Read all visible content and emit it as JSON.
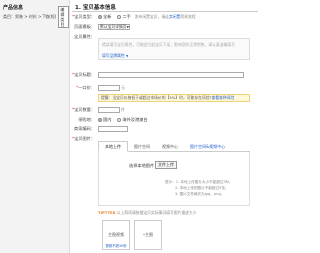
{
  "sidebar": {
    "title": "产品信息",
    "crumb": "类目：男装 > 衬衫 > T恤(短)",
    "edit_label": "编辑类目"
  },
  "section": {
    "title": "1. 宝贝基本信息"
  },
  "form": {
    "type_label": "宝贝类型：",
    "type_options": [
      "全新",
      "二手"
    ],
    "type_hint": "发布闲置宝贝，请走",
    "type_hint_link": "卖闲置",
    "type_hint_tail": "简易流程",
    "attr_label": "页面模板：",
    "attr_select": "默认宝贝详情页",
    "props_label": "宝贝属性：",
    "props_placeholder": "错误填写宝贝属性，可能会引起宝贝下架，影响您的正常销售，请认真准确填写",
    "props_link": "填写品牌属性",
    "title_label": "宝贝标题：",
    "title_counter": "还能输入 30 字",
    "price_label": "一口价：",
    "price_unit": "元",
    "warning_text": "提醒：当宝贝价格低于或超过市场价的【5%】时，可能存在风险?",
    "warning_link": "查看各种风险",
    "qty_label": "宝贝数量：",
    "qty_unit": "件",
    "location_label": "采购地：",
    "location_options": [
      "国内",
      "海外及港澳台"
    ],
    "merchant_label": "商家编码：",
    "image_label": "宝贝图片："
  },
  "tabs": [
    "本地上传",
    "图片空间",
    "视频中心",
    "图片空间&视频中心"
  ],
  "upload": {
    "file_label": "选择本地图片：",
    "file_button": "文件上传",
    "tips": [
      "提示：1. 本地上传图片大小不能超过3M。",
      "2. 本地上传的图片不能超过5张。",
      "3. 图片文件格式为jpg、png。"
    ]
  },
  "bottom": {
    "highlight": "TIPTTER",
    "note": "以上两项请依据宝贝实际情况填写图片描述大小"
  },
  "thumbs": [
    {
      "label": "主图视频",
      "sub": "视频不超30秒"
    },
    {
      "label": "主图",
      "required": "*"
    }
  ]
}
